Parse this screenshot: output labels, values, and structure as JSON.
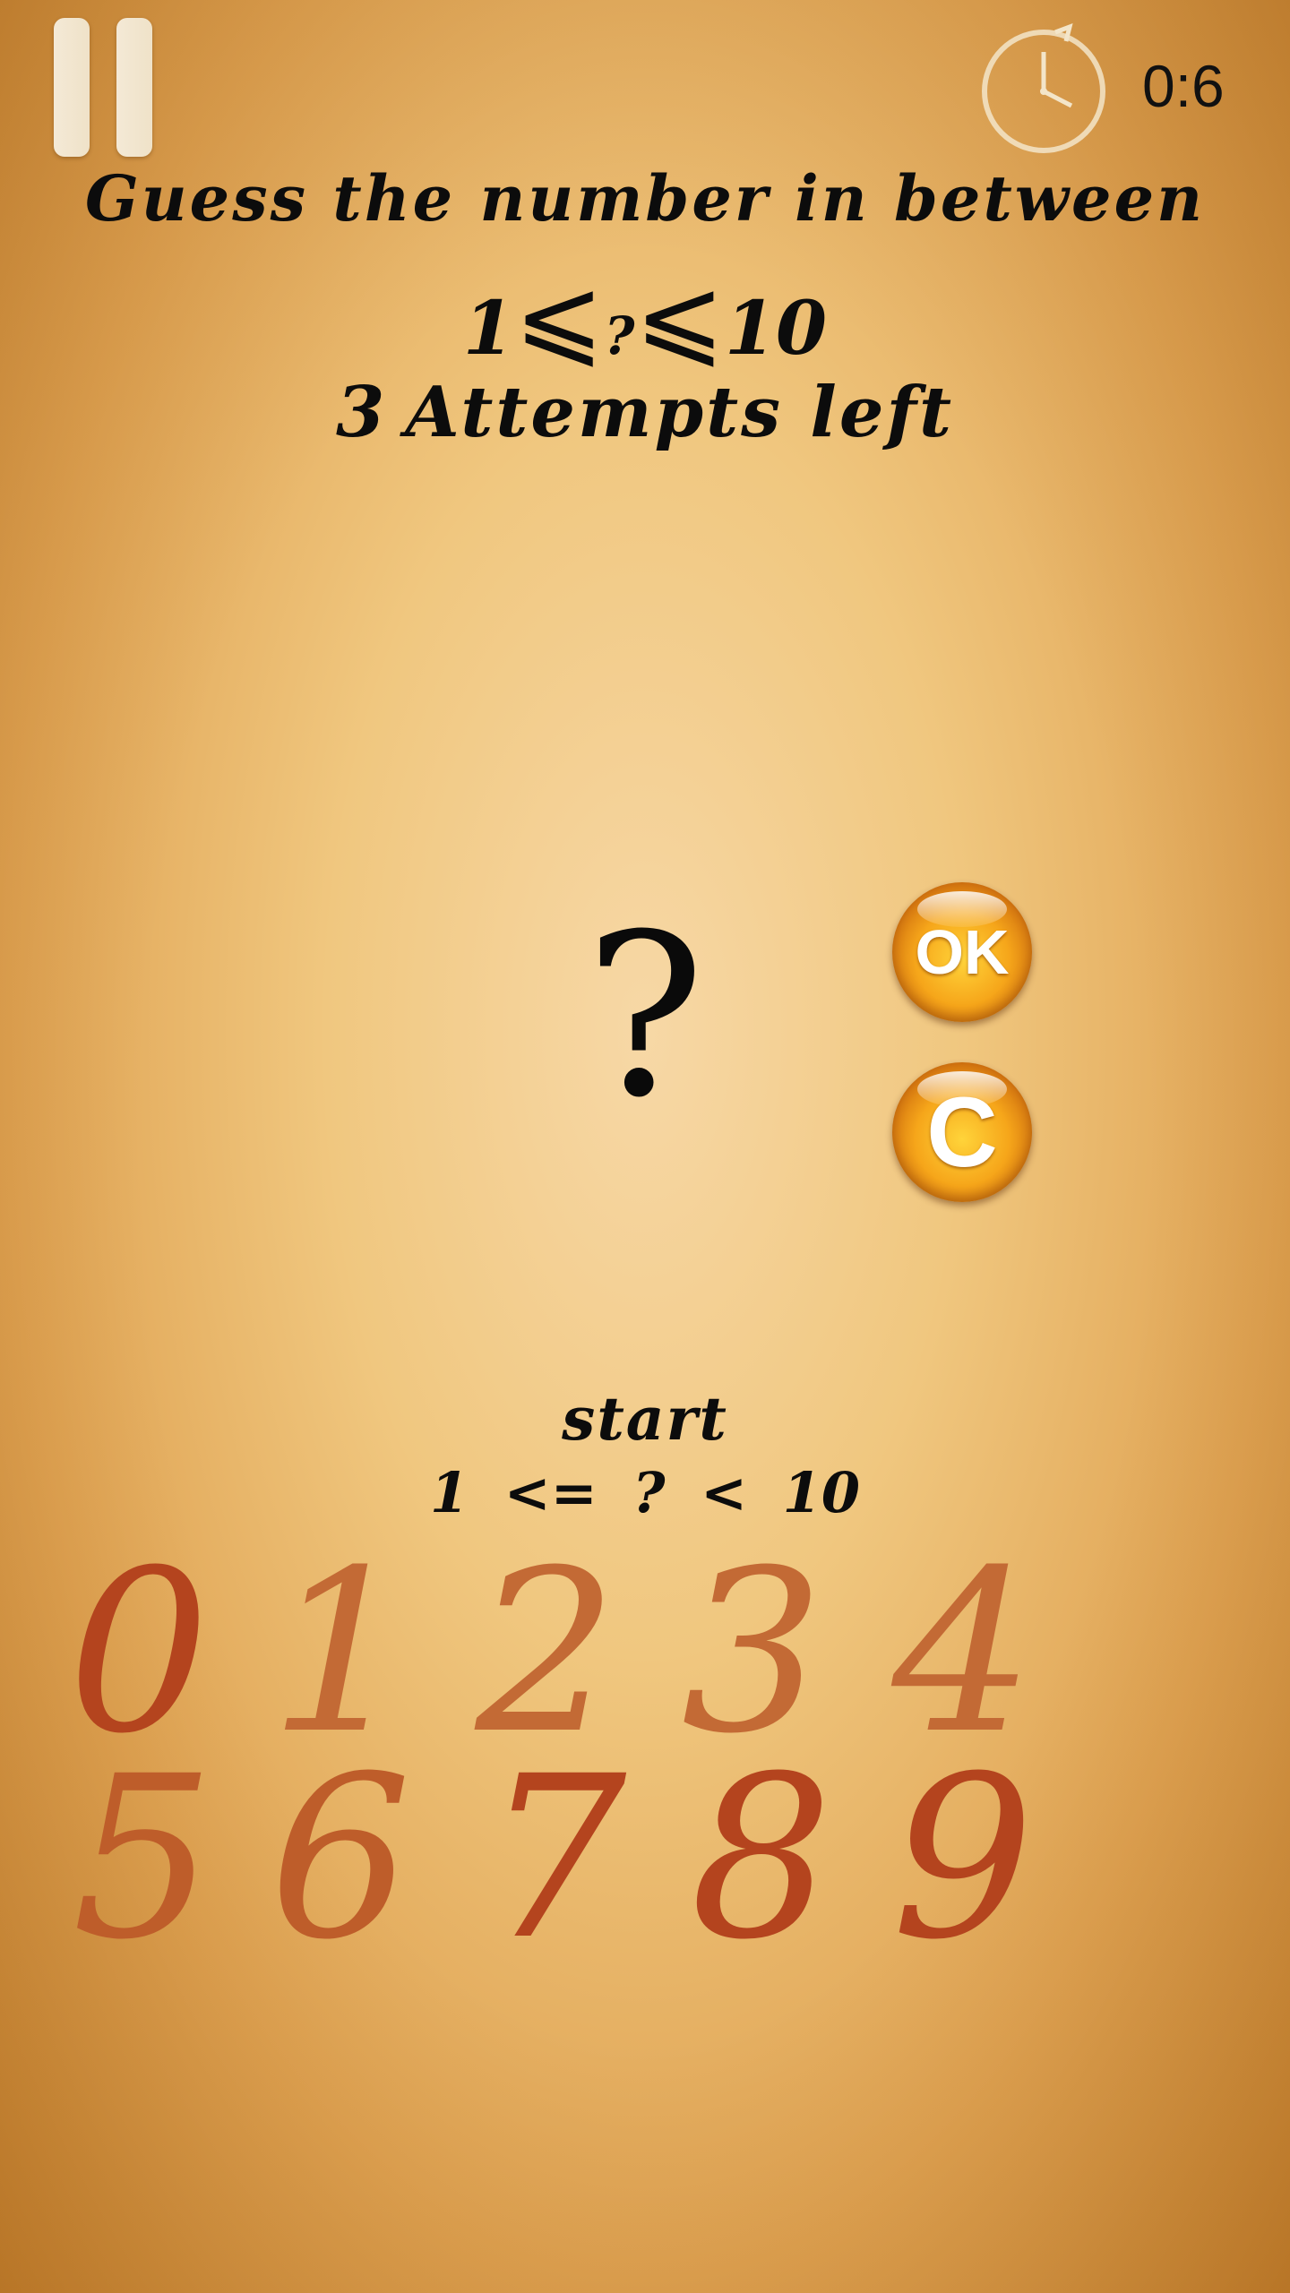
{
  "hud": {
    "timer": "0:6",
    "pause_icon": "pause-icon",
    "clock_icon": "clock-icon"
  },
  "prompt": {
    "title": "Guess the number in between",
    "range_min": "1",
    "range_symbol": "⩽",
    "range_placeholder": "?",
    "range_max": "10",
    "attempts_count": "3",
    "attempts_text": "Attempts left"
  },
  "guess": {
    "display": "?"
  },
  "buttons": {
    "ok_label": "OK",
    "clear_label": "C"
  },
  "hint": {
    "label": "start",
    "range_text": "1 <= ? < 10"
  },
  "keypad": {
    "row1": [
      "0",
      "1",
      "2",
      "3",
      "4"
    ],
    "row2": [
      "5",
      "6",
      "7",
      "8",
      "9"
    ]
  },
  "colors": {
    "digit_dark": "#b4441e",
    "digit_light": "#c36a35",
    "orb": "#f6a61a"
  }
}
